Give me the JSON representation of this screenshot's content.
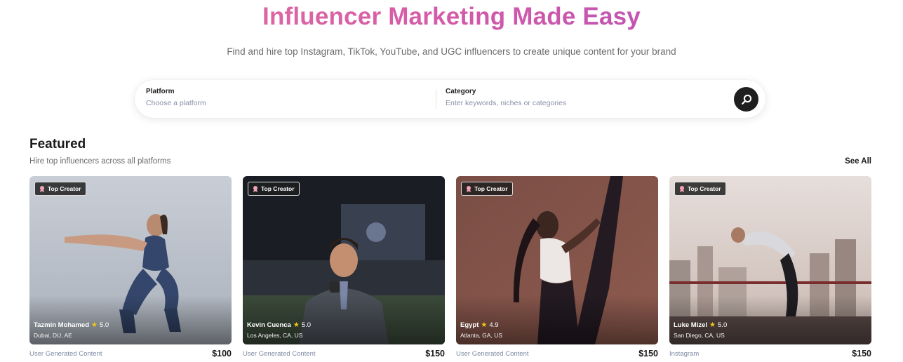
{
  "hero": {
    "title": "Influencer Marketing Made Easy",
    "subtitle": "Find and hire top Instagram, TikTok, YouTube, and UGC influencers to create unique content for your brand"
  },
  "search": {
    "platform_label": "Platform",
    "platform_placeholder": "Choose a platform",
    "category_label": "Category",
    "category_placeholder": "Enter keywords, niches or categories",
    "button_icon": "search-icon"
  },
  "featured": {
    "title": "Featured",
    "subtitle": "Hire top influencers across all platforms",
    "see_all": "See All",
    "cards": [
      {
        "badge": "Top Creator",
        "name": "Tazmin Mohamed",
        "rating": "5.0",
        "location": "Dubai, DU, AE",
        "category": "User Generated Content",
        "price": "$100"
      },
      {
        "badge": "Top Creator",
        "name": "Kevin Cuenca",
        "rating": "5.0",
        "location": "Los Angeles, CA, US",
        "category": "User Generated Content",
        "price": "$150"
      },
      {
        "badge": "Top Creator",
        "name": "Egypt",
        "rating": "4.9",
        "location": "Atlanta, GA, US",
        "category": "User Generated Content",
        "price": "$150"
      },
      {
        "badge": "Top Creator",
        "name": "Luke Mizel",
        "rating": "5.0",
        "location": "San Diego, CA, US",
        "category": "Instagram",
        "price": "$150"
      }
    ]
  },
  "colors": {
    "title_gradient_start": "#e9779a",
    "title_gradient_end": "#a94bbf",
    "search_button": "#1f1f1f",
    "star": "#f5c518",
    "category_text": "#7d8aa3"
  }
}
